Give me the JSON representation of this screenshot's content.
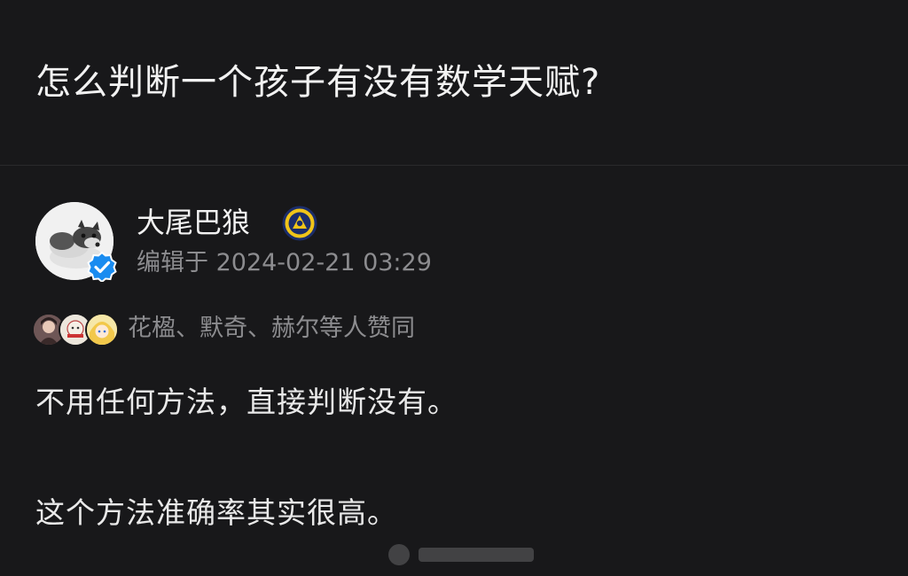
{
  "question": {
    "title": "怎么判断一个孩子有没有数学天赋?"
  },
  "author": {
    "name": "大尾巴狼",
    "avatar": "dog-avatar",
    "badge": "verified-icon",
    "medal": "medal-icon",
    "edit_time": "编辑于 2024-02-21 03:29"
  },
  "upvotes": {
    "avatars": [
      "voter-avatar-1",
      "voter-avatar-2",
      "voter-avatar-3"
    ],
    "text": "花楹、默奇、赫尔等人赞同"
  },
  "answer": {
    "paragraphs": [
      "不用任何方法，直接判断没有。",
      "这个方法准确率其实很高。"
    ]
  },
  "colors": {
    "background": "#18181a",
    "primary_text": "#f2f2f2",
    "secondary_text": "#8c8c8f",
    "verified_blue": "#1a8cf0"
  }
}
